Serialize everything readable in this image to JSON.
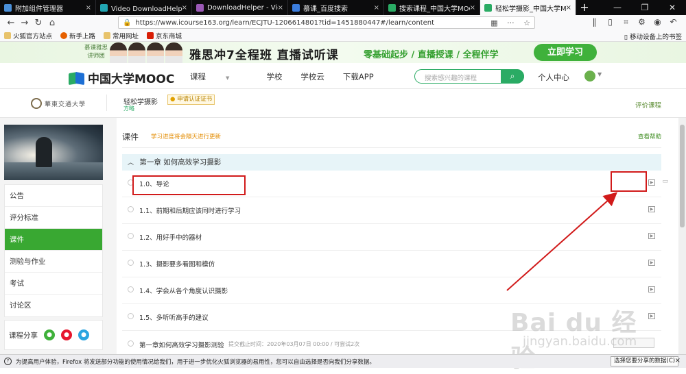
{
  "browser": {
    "tabs": [
      {
        "title": "附加组件管理器",
        "icon_color": "#4a90d9",
        "active": false
      },
      {
        "title": "Video DownloadHelper – 下载",
        "icon_color": "#22a6b3",
        "active": false
      },
      {
        "title": "DownloadHelper - Video do",
        "icon_color": "#9b59b6",
        "active": false
      },
      {
        "title": "慕课_百度搜索",
        "icon_color": "#3b7ddd",
        "active": false
      },
      {
        "title": "搜索课程_中国大学MOOC(慕课)",
        "icon_color": "#2aab64",
        "active": false
      },
      {
        "title": "轻松学摄影_中国大学MOOC(慕课)",
        "icon_color": "#2aab64",
        "active": true
      }
    ],
    "tab_close": "×",
    "new_tab": "+",
    "url": "https://www.icourse163.org/learn/ECJTU-1206614801?tid=1451880447#/learn/content",
    "bookmarks": [
      {
        "label": "火狐官方站点",
        "color": "#7a5c2e"
      },
      {
        "label": "新手上路",
        "color": "#e66000"
      },
      {
        "label": "常用网址",
        "color": "#7a5c2e"
      },
      {
        "label": "京东商城",
        "color": "#d81e06"
      }
    ],
    "mobile_bookmarks": "移动设备上的书签"
  },
  "banner": {
    "teachers_label": "慕课雅思讲师团",
    "headline": "雅思冲7全程班 直播试听课",
    "subline": "零基础起步 / 直播授课 / 全程伴学",
    "cta": "立即学习"
  },
  "header": {
    "logo_text": "中国大学MOOC",
    "nav": [
      "课程",
      "学校",
      "学校云",
      "下载APP"
    ],
    "search_placeholder": "搜索感兴趣的课程",
    "personal_center": "个人中心"
  },
  "course": {
    "university": "華東交通大學",
    "name": "轻松学摄影",
    "teacher": "方略",
    "cert_button": "申请认证证书",
    "evaluate": "评价课程"
  },
  "sidebar": {
    "items": [
      {
        "label": "公告",
        "active": false
      },
      {
        "label": "评分标准",
        "active": false
      },
      {
        "label": "课件",
        "active": true
      },
      {
        "label": "测验与作业",
        "active": false
      },
      {
        "label": "考试",
        "active": false
      },
      {
        "label": "讨论区",
        "active": false
      }
    ],
    "share_label": "课程分享",
    "share_icons": [
      {
        "name": "wechat",
        "color": "#3fb13b"
      },
      {
        "name": "weibo",
        "color": "#e6162d"
      },
      {
        "name": "qq",
        "color": "#2ca5e0"
      }
    ]
  },
  "content": {
    "title": "课件",
    "note": "学习进度将会隔天进行更新",
    "help": "查看帮助",
    "chapter": "第一章 如何高效学习摄影",
    "lessons": [
      "1.0、导论",
      "1.1、前期和后期应该同时进行学习",
      "1.2、用好手中的器材",
      "1.3、摄影要多看图和模仿",
      "1.4、学会从各个角度认识摄影",
      "1.5、多听听高手的建议"
    ],
    "quiz": {
      "name": "第一章如何高效学习摄影测验",
      "meta": "提交截止时间：2020年03月07日 00:00 / 可尝试2次"
    }
  },
  "watermark": {
    "main": "Bai du 经验",
    "sub": "jingyan.baidu.com"
  },
  "notification": {
    "text": "为提高用户体验，Firefox 将发送部分功能的使用情况给我们，用于进一步优化火狐浏览器的易用性，您可以自由选择是否向我们分享数据。",
    "button": "选择您要分享的数据(C)",
    "close": "×"
  },
  "colors": {
    "accent": "#2aab64",
    "sidebar_active": "#39a832",
    "annotation": "#d11a1a"
  }
}
